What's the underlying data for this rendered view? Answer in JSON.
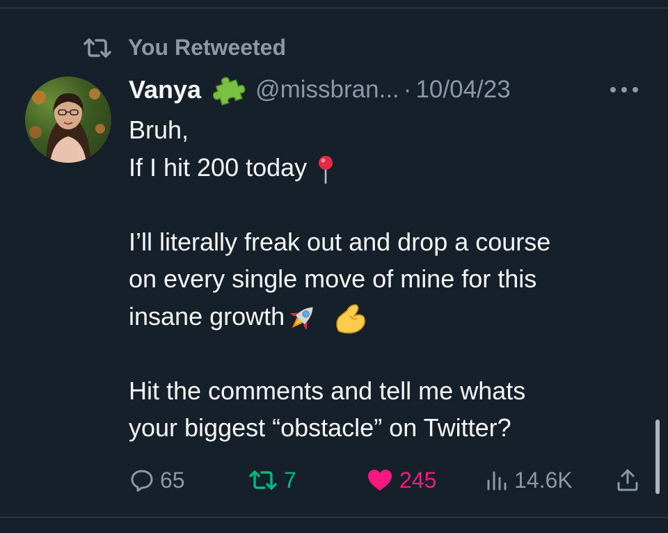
{
  "retweet_context": {
    "label": "You Retweeted",
    "icon": "retweet-icon"
  },
  "author": {
    "display_name": "Vanya",
    "badge_icon": "puzzle-piece-icon",
    "handle": "@missbran...",
    "separator": "·",
    "date": "10/04/23",
    "avatar_icon": "avatar"
  },
  "tweet": {
    "lines": [
      "Bruh,",
      "If I hit 200 today",
      "",
      "I’ll literally freak out and drop a course",
      "on every single move of mine for this",
      "insane growth",
      "",
      "Hit the comments and tell me whats",
      "your biggest “obstacle” on Twitter?"
    ]
  },
  "actions": {
    "replies": "65",
    "retweets": "7",
    "likes": "245",
    "views": "14.6K"
  },
  "colors": {
    "background": "#15202b",
    "secondary_text": "#8b98a5",
    "primary_text": "#f7f9f9",
    "retweet_active": "#00ba7c",
    "like_active": "#f91880",
    "badge_green": "#7ac142"
  }
}
